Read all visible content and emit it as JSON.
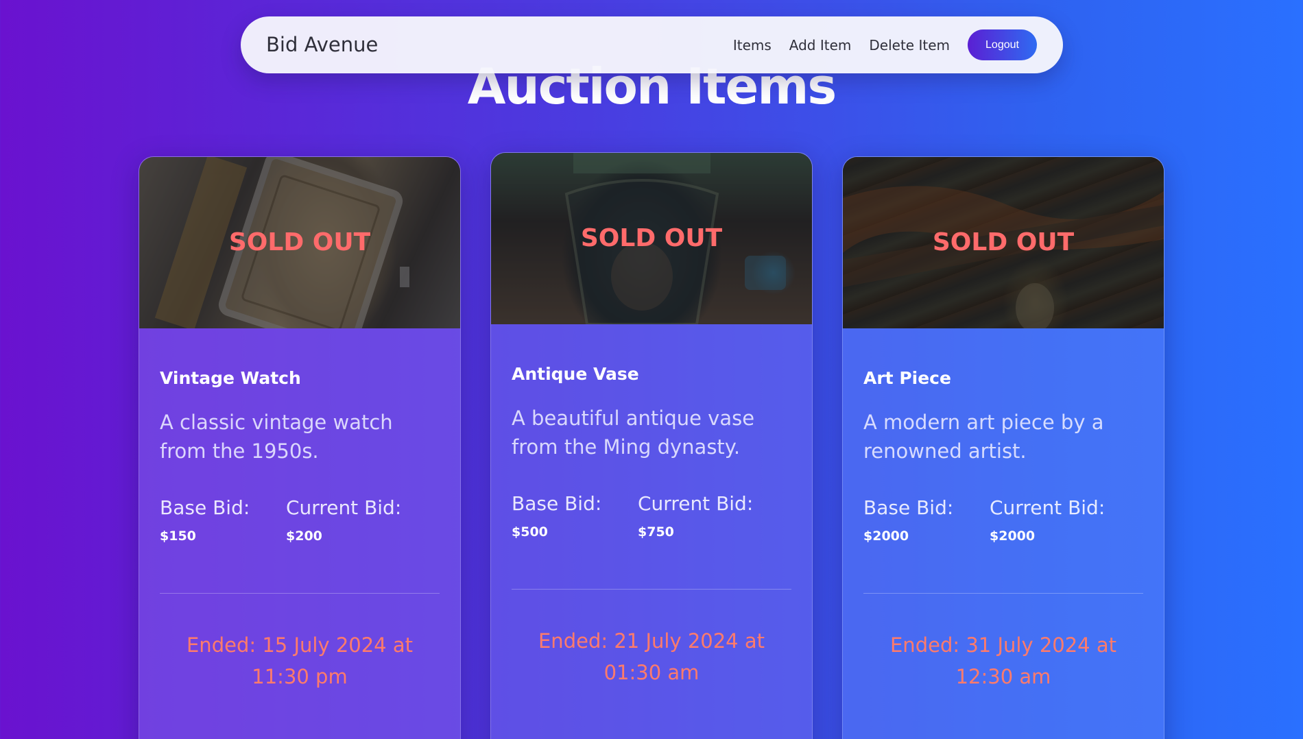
{
  "navbar": {
    "brand": "Bid Avenue",
    "links": [
      "Items",
      "Add Item",
      "Delete Item"
    ],
    "logout_label": "Logout"
  },
  "page": {
    "title": "Auction Items"
  },
  "items": [
    {
      "image_icon": "watch-image",
      "status": "SOLD OUT",
      "name": "Vintage Watch",
      "description": "A classic vintage watch from the 1950s.",
      "base_bid_label": "Base Bid:",
      "base_bid": "$150",
      "current_bid_label": "Current Bid:",
      "current_bid": "$200",
      "ended": "Ended: 15 July 2024 at 11:30 pm"
    },
    {
      "image_icon": "vase-image",
      "status": "SOLD OUT",
      "name": "Antique Vase",
      "description": "A beautiful antique vase from the Ming dynasty.",
      "base_bid_label": "Base Bid:",
      "base_bid": "$500",
      "current_bid_label": "Current Bid:",
      "current_bid": "$750",
      "ended": "Ended: 21 July 2024 at 01:30 am"
    },
    {
      "image_icon": "art-image",
      "status": "SOLD OUT",
      "name": "Art Piece",
      "description": "A modern art piece by a renowned artist.",
      "base_bid_label": "Base Bid:",
      "base_bid": "$2000",
      "current_bid_label": "Current Bid:",
      "current_bid": "$2000",
      "ended": "Ended: 31 July 2024 at 12:30 am"
    }
  ],
  "colors": {
    "sold_out": "#ff6b6b",
    "ended": "#ff7b6b",
    "logout_gradient_start": "#5b1fd3",
    "logout_gradient_end": "#2f6bf2"
  }
}
